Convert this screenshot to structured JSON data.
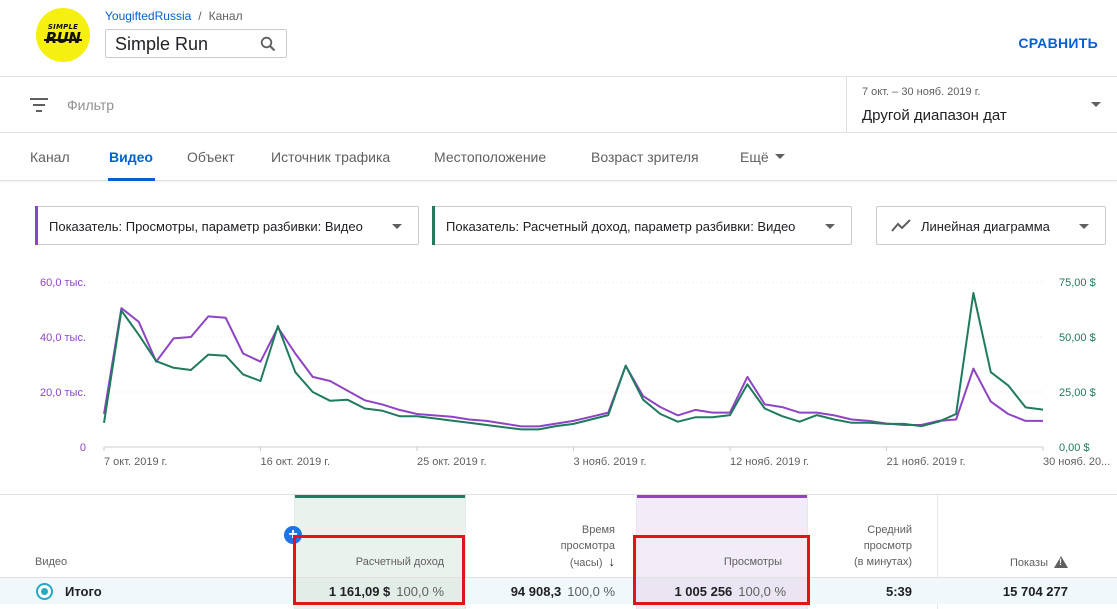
{
  "header": {
    "logo_top": "SIMPLE",
    "logo_bottom": "RUN",
    "breadcrumb_channel": "YougiftedRussia",
    "breadcrumb_sep": "/",
    "breadcrumb_page": "Канал",
    "channel_name": "Simple Run",
    "compare_label": "СРАВНИТЬ"
  },
  "filter": {
    "placeholder": "Фильтр",
    "date_range_small": "7 окт. – 30 нояб. 2019 г.",
    "date_range_label": "Другой диапазон дат"
  },
  "tabs": [
    {
      "label": "Канал"
    },
    {
      "label": "Видео"
    },
    {
      "label": "Объект"
    },
    {
      "label": "Источник трафика"
    },
    {
      "label": "Местоположение"
    },
    {
      "label": "Возраст зрителя"
    },
    {
      "label": "Ещё"
    }
  ],
  "selectors": {
    "metric1": "Показатель: Просмотры, параметр разбивки: Видео",
    "metric2": "Показатель: Расчетный доход, параметр разбивки: Видео",
    "chart_type": "Линейная диаграмма"
  },
  "colors": {
    "views": "#8e44c4",
    "revenue": "#1f7a5e",
    "accent": "#065fd4",
    "highlight": "#e3131b"
  },
  "chart_data": {
    "type": "line",
    "left_axis_ticks": [
      "60,0 тыс.",
      "40,0 тыс.",
      "20,0 тыс.",
      "0"
    ],
    "right_axis_ticks": [
      "75,00 $",
      "50,00 $",
      "25,00 $",
      "0,00 $"
    ],
    "x_tick_labels": [
      "7 окт. 2019 г.",
      "16 окт. 2019 г.",
      "25 окт. 2019 г.",
      "3 нояб. 2019 г.",
      "12 нояб. 2019 г.",
      "21 нояб. 2019 г.",
      "30 нояб. 20..."
    ],
    "ylim_left": [
      0,
      60000
    ],
    "ylim_right": [
      0,
      75
    ],
    "series": [
      {
        "name": "Просмотры",
        "axis": "left",
        "values": [
          12000,
          50500,
          45500,
          31000,
          39500,
          40000,
          47500,
          47000,
          34000,
          31000,
          43500,
          34000,
          25500,
          24000,
          20500,
          17000,
          15500,
          13500,
          12000,
          11500,
          11000,
          10000,
          9500,
          8500,
          7500,
          7500,
          8500,
          9500,
          11000,
          12500,
          29500,
          18500,
          14500,
          11500,
          13500,
          12500,
          12500,
          25500,
          15500,
          14500,
          12500,
          12500,
          11500,
          10000,
          9500,
          8500,
          8000,
          8000,
          9500,
          10000,
          28500,
          16500,
          12000,
          9500,
          9500
        ]
      },
      {
        "name": "Расчетный доход",
        "axis": "right",
        "values": [
          11,
          62,
          51,
          39,
          36,
          35,
          42,
          41.5,
          33,
          30,
          55,
          34,
          25,
          21,
          21.5,
          17.5,
          16.5,
          14,
          14,
          13,
          12,
          11,
          10,
          9,
          8,
          8,
          9.5,
          10.5,
          12.5,
          14.5,
          37,
          21.5,
          15,
          11.5,
          13.5,
          13.5,
          14.5,
          28.5,
          17.5,
          14,
          11.5,
          14.5,
          12.5,
          11,
          11,
          10.5,
          10.5,
          9.5,
          11.5,
          15,
          70,
          34,
          28,
          18,
          17
        ]
      }
    ]
  },
  "table": {
    "col_video": "Видео",
    "col_revenue": "Расчетный доход",
    "col_watch_l1": "Время",
    "col_watch_l2": "просмотра",
    "col_watch_l3": "(часы)",
    "col_views": "Просмотры",
    "col_avg_l1": "Средний",
    "col_avg_l2": "просмотр",
    "col_avg_l3": "(в минутах)",
    "col_impressions": "Показы",
    "total_label": "Итого",
    "revenue_value": "1 161,09 $",
    "revenue_pct": "100,0 %",
    "watch_value": "94 908,3",
    "watch_pct": "100,0 %",
    "views_value": "1 005 256",
    "views_pct": "100,0 %",
    "avg_value": "5:39",
    "impressions_value": "15 704 277",
    "plus_label": "+",
    "sort_arrow": "↓"
  }
}
